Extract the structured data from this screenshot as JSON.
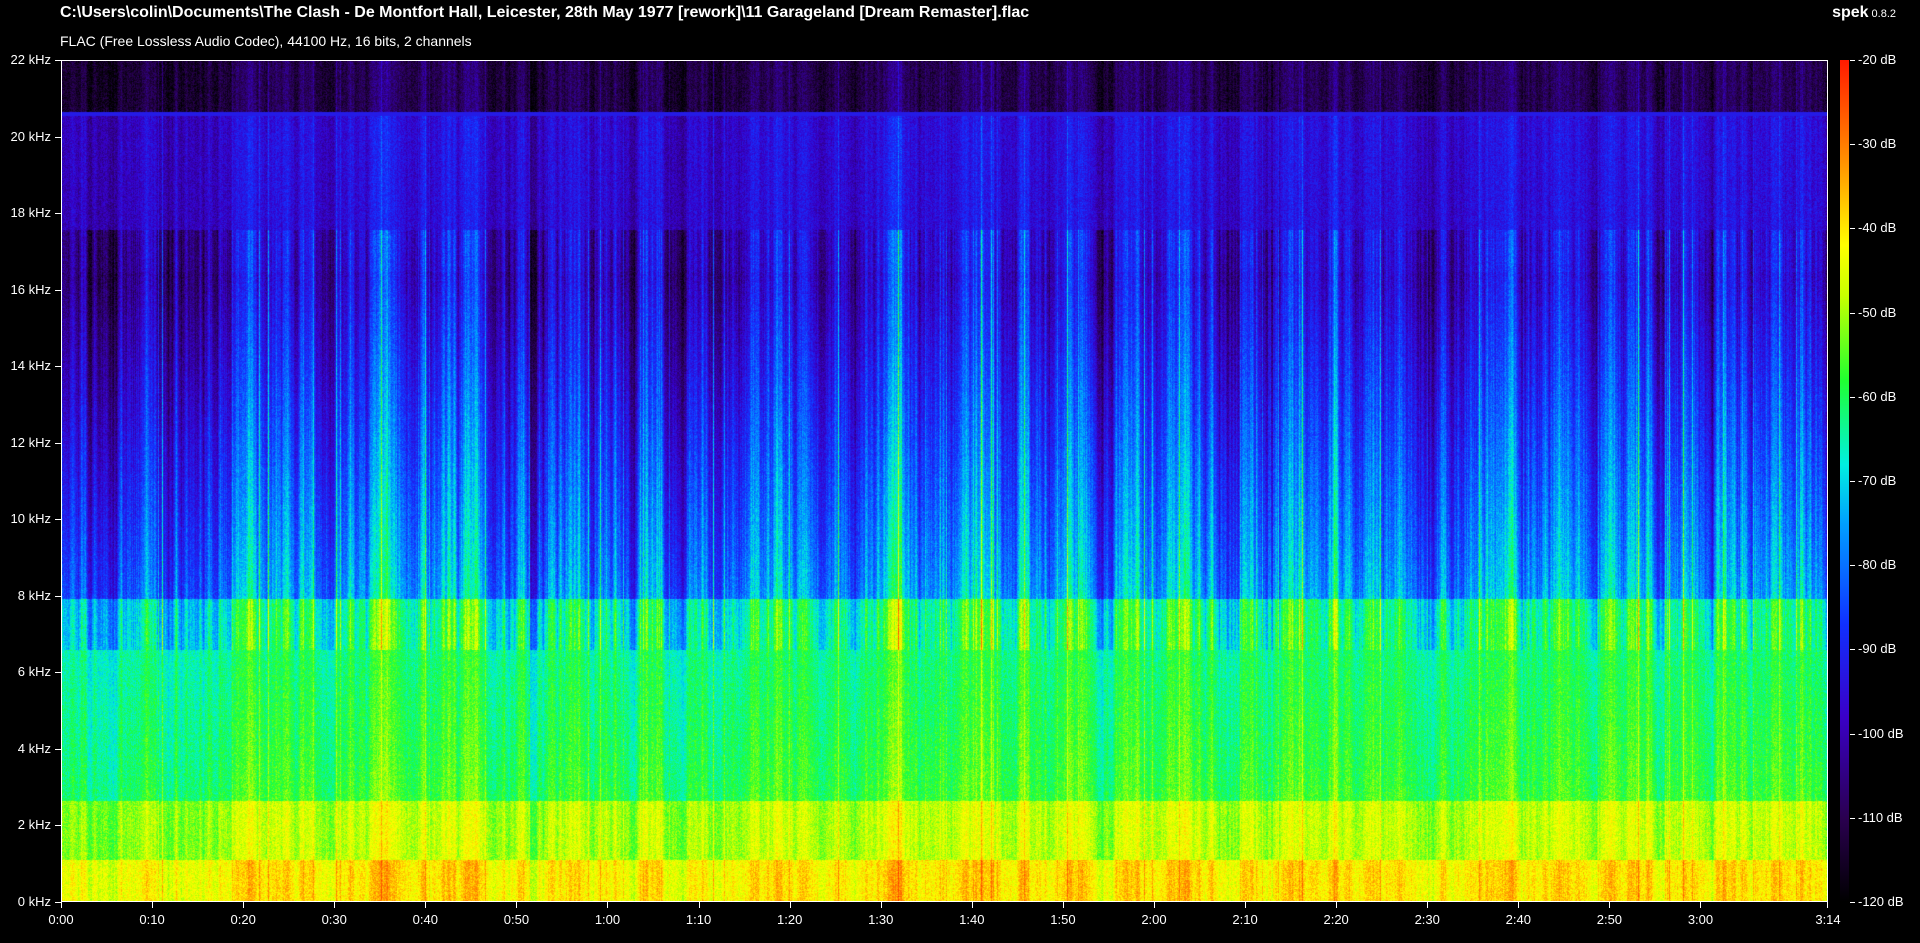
{
  "header": {
    "file_path": "C:\\Users\\colin\\Documents\\The Clash - De Montfort Hall, Leicester, 28th May 1977 [rework]\\11 Garageland [Dream Remaster].flac",
    "format_info": "FLAC (Free Lossless Audio Codec), 44100 Hz, 16 bits, 2 channels",
    "app_name": "spek",
    "app_version": "0.8.2"
  },
  "axes": {
    "frequency_ticks": [
      "0 kHz",
      "2 kHz",
      "4 kHz",
      "6 kHz",
      "8 kHz",
      "10 kHz",
      "12 kHz",
      "14 kHz",
      "16 kHz",
      "18 kHz",
      "20 kHz",
      "22 kHz"
    ],
    "time_ticks": [
      "0:00",
      "0:10",
      "0:20",
      "0:30",
      "0:40",
      "0:50",
      "1:00",
      "1:10",
      "1:20",
      "1:30",
      "1:40",
      "1:50",
      "2:00",
      "2:10",
      "2:20",
      "2:30",
      "2:40",
      "2:50",
      "3:00",
      "3:14"
    ],
    "duration_seconds": 194,
    "max_frequency_khz": 22
  },
  "colorbar": {
    "labels": [
      "-20 dB",
      "-30 dB",
      "-40 dB",
      "-50 dB",
      "-60 dB",
      "-70 dB",
      "-80 dB",
      "-90 dB",
      "-100 dB",
      "-110 dB",
      "-120 dB"
    ],
    "max_db": -20,
    "min_db": -120
  }
}
